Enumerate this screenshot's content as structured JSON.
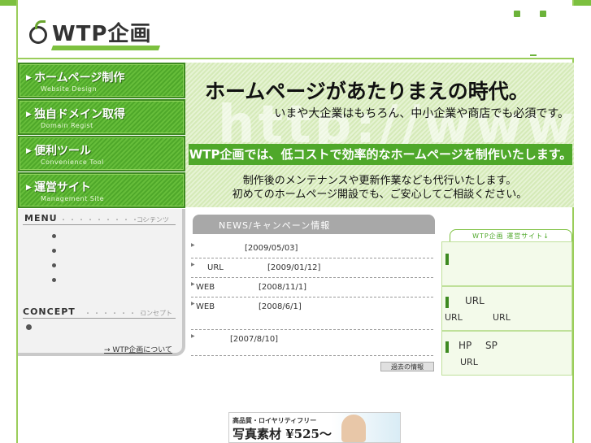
{
  "header": {
    "logo_text": "WTP企画"
  },
  "nav": [
    {
      "label": "ホームページ制作",
      "sub": "Website Design"
    },
    {
      "label": "独自ドメイン取得",
      "sub": "Domain Regist"
    },
    {
      "label": "便利ツール",
      "sub": "Convenience Tool"
    },
    {
      "label": "運営サイト",
      "sub": "Management Site"
    }
  ],
  "hero": {
    "watermark": "http://www",
    "title": "ホームページがあたりまえの時代。",
    "subtitle": "いまや大企業はもちろん、中小企業や商店でも必須です。",
    "band": "WTP企画では、低コストで効率的なホームページを制作いたします。",
    "para1": "制作後のメンテナンスや更新作業なども代行いたします。",
    "para2": "初めてのホームページ開設でも、ご安心してご相談ください。"
  },
  "sidebar": {
    "menu_title": "MENU",
    "menu_dots": "・・・・・・・・・・・",
    "menu_sub": "コンテンツ",
    "concept_title": "CONCEPT",
    "concept_dots": "・・・・・・・",
    "concept_sub": "コンセプト",
    "about_link": "→ WTP企画について"
  },
  "news": {
    "tab_title": "NEWS/キャンペーン情報",
    "rows": [
      {
        "label": "",
        "date": "[2009/05/03]"
      },
      {
        "label": "URL",
        "date": "[2009/01/12]"
      },
      {
        "label": "WEB",
        "date": "[2008/11/1]"
      },
      {
        "label": "WEB",
        "date": "[2008/6/1]"
      },
      {
        "label": "",
        "date": "[2007/8/10]"
      }
    ],
    "past_button": "過去の情報"
  },
  "sites": {
    "tab_title": "WTP企画 運営サイト↓",
    "box2_line1": "URL",
    "box2_line2a": "URL",
    "box2_line2b": "URL",
    "box3_line1a": "HP",
    "box3_line1b": "SP",
    "box3_line2": "URL"
  },
  "banner": {
    "line1": "高品質・ロイヤリティフリー",
    "line2": "写真素材 ¥525～"
  },
  "colors": {
    "accent": "#4fa82a",
    "accent_dark": "#3d8a20",
    "hero_bg": "#dff0c8"
  }
}
